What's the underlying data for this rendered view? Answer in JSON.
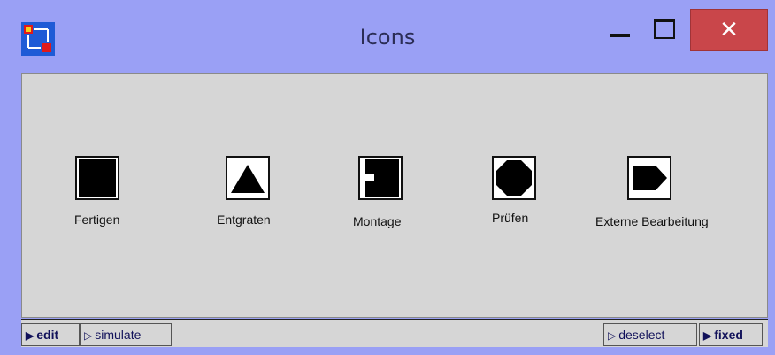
{
  "window": {
    "title": "Icons",
    "app_icon": "app-logo-icon",
    "controls": {
      "minimize": "minimize-icon",
      "maximize": "maximize-icon",
      "close": "close-icon",
      "close_glyph": "✕"
    },
    "colors": {
      "frame": "#9aa0f5",
      "close": "#c9464a",
      "canvas": "#d6d6d6"
    }
  },
  "icons": [
    {
      "label": "Fertigen",
      "shape": "square"
    },
    {
      "label": "Entgraten",
      "shape": "triangle"
    },
    {
      "label": "Montage",
      "shape": "notched-square"
    },
    {
      "label": "Prüfen",
      "shape": "octagon"
    },
    {
      "label": "Externe Bearbeitung",
      "shape": "pentagon-arrow"
    }
  ],
  "statusbar": {
    "edit": "edit",
    "simulate": "simulate",
    "deselect": "deselect",
    "fixed": "fixed",
    "arrow_filled": "▶",
    "arrow_outline": "▷"
  }
}
